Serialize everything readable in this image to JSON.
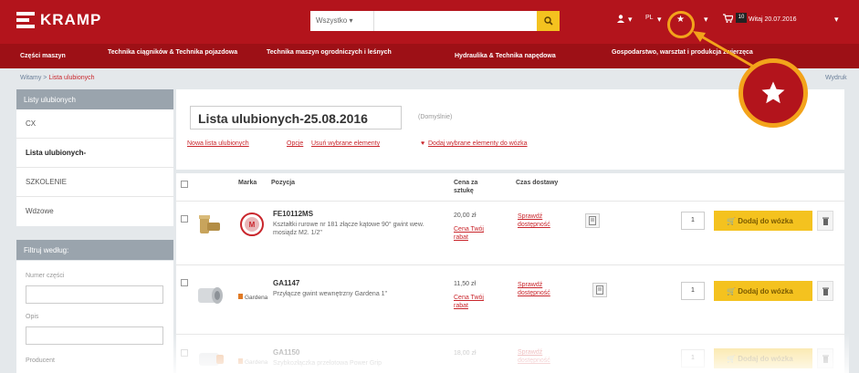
{
  "header": {
    "logo_text": "KRAMP",
    "search_category": "Wszystko ▾",
    "search_placeholder": "",
    "welcome": "Witaj 20.07.2016",
    "cart_count": "10",
    "lang": "PL"
  },
  "nav": {
    "items": [
      "Części maszyn",
      "Technika ciągników & Technika pojazdowa",
      "Technika maszyn ogrodniczych i leśnych",
      "Hydraulika & Technika napędowa",
      "Gospodarstwo, warsztat i produkcja zwierzęca"
    ]
  },
  "breadcrumb": {
    "home": "Witamy",
    "sep": " > ",
    "current": "Lista ulubionych",
    "print": "Wydruk"
  },
  "sidebar": {
    "lists_heading": "Listy ulubionych",
    "lists": [
      "CX",
      "Lista ulubionych-",
      "SZKOLENIE",
      "Wdzowe"
    ],
    "filter_heading": "Filtruj według:",
    "filter_labels": [
      "Numer części",
      "Opis",
      "Producent"
    ]
  },
  "list": {
    "title": "Lista ulubionych-25.08.2016",
    "default_tag": "(Domyślnie)",
    "actions": {
      "new_list": "Nowa lista ulubionych",
      "options": "Opcje",
      "remove_selected": "Usuń wybrane elementy",
      "add_selected_to_cart": "Dodaj wybrane elementy do wózka"
    }
  },
  "table": {
    "headers": {
      "brand": "Marka",
      "item": "Pozycja",
      "price": "Cena za sztukę",
      "delivery": "Czas dostawy"
    },
    "rows": [
      {
        "part_no": "FE10112MS",
        "desc": "Kształtki rurowe nr 181 złącze kątowe 90° gwint wew. mosiądz M2. 1/2\"",
        "price": "20,00 zł",
        "price_link": "Cena Twój rabat",
        "stock_link": "Sprawdź dostępność",
        "qty": "1",
        "add_label": "Dodaj do wózka"
      },
      {
        "part_no": "GA1147",
        "desc": "Przyłącze gwint wewnętrzny Gardena 1\"",
        "price": "11,50 zł",
        "price_link": "Cena Twój rabat",
        "stock_link": "Sprawdź dostępność",
        "qty": "1",
        "add_label": "Dodaj do wózka"
      },
      {
        "part_no": "GA1150",
        "desc": "Szybkozłączka przelotowa Power Grip",
        "price": "18,00 zł",
        "price_link": "",
        "stock_link": "Sprawdź dostępność",
        "qty": "1",
        "add_label": "Dodaj do wózka"
      }
    ]
  },
  "colors": {
    "brand_red": "#b3141c",
    "accent_yellow": "#f4c21f",
    "annotation_orange": "#f3a31b"
  }
}
